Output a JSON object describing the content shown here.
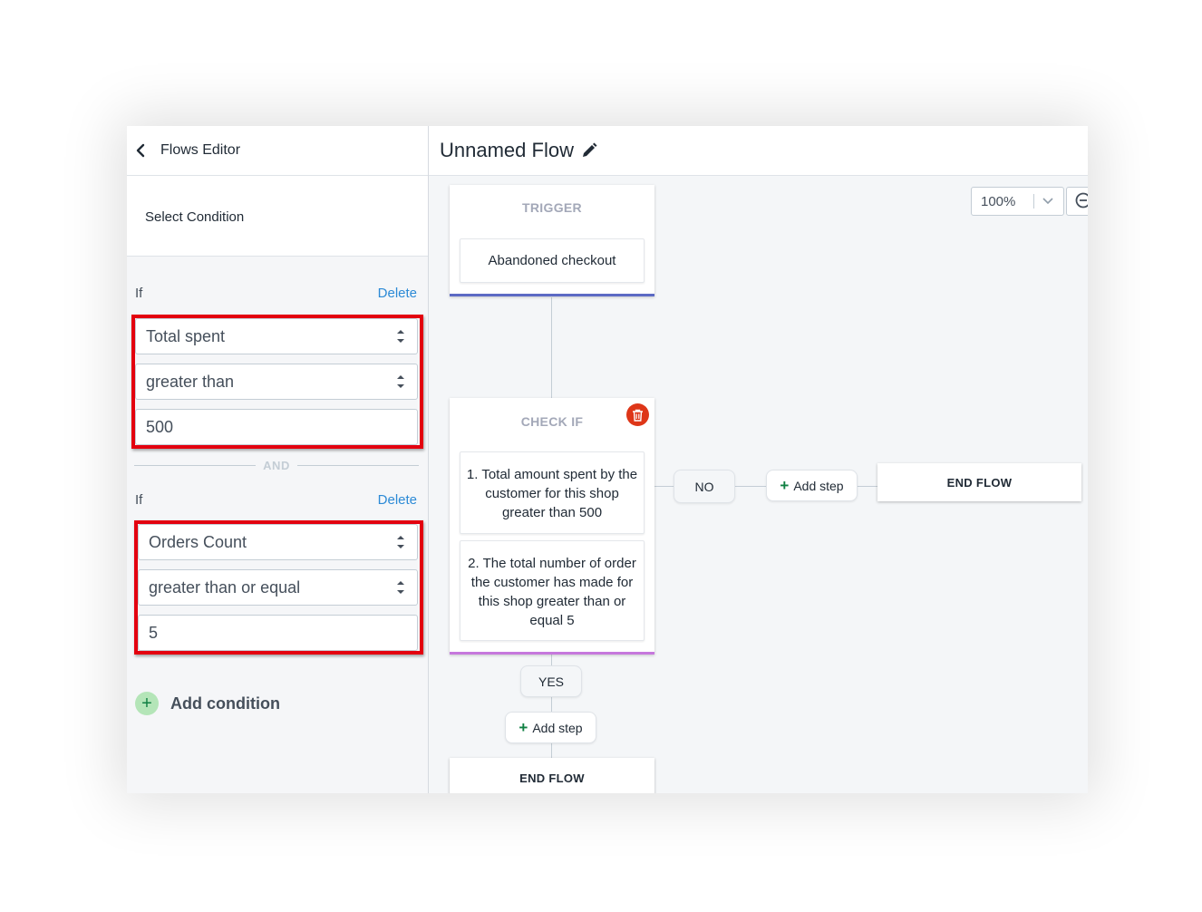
{
  "sidebar": {
    "back_label": "Flows Editor",
    "section_title": "Select Condition",
    "conditions": [
      {
        "if_label": "If",
        "delete_label": "Delete",
        "field": "Total spent",
        "operator": "greater than",
        "value": "500"
      },
      {
        "if_label": "If",
        "delete_label": "Delete",
        "field": "Orders Count",
        "operator": "greater than or equal",
        "value": "5"
      }
    ],
    "and_label": "AND",
    "add_condition_icon": "+",
    "add_condition_label": "Add condition"
  },
  "main": {
    "flow_title": "Unnamed Flow",
    "zoom_value": "100%",
    "trigger": {
      "title": "TRIGGER",
      "event": "Abandoned checkout"
    },
    "check": {
      "title": "CHECK IF",
      "conditions": [
        "1. Total amount spent by the customer for this shop greater than 500",
        "2. The total number of order the customer has made for this shop greater than or equal 5"
      ]
    },
    "no_label": "NO",
    "yes_label": "YES",
    "add_step_icon": "+",
    "add_step_label": "Add step",
    "end_flow_label": "END FLOW"
  },
  "colors": {
    "highlight_border": "#e3000f",
    "link": "#2c8ad6",
    "trigger_accent": "#5c6ac4",
    "check_accent": "#c678dd",
    "delete_red": "#de3618",
    "add_green": "#108043"
  }
}
